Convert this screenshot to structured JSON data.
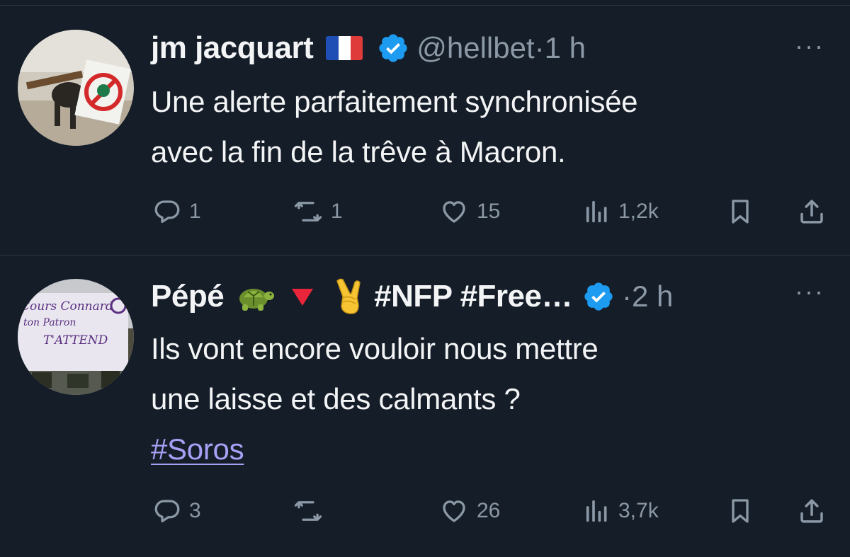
{
  "tweets": [
    {
      "display_name": "jm jacquart",
      "handle": "@hellbet",
      "separator": "·",
      "time": "1 h",
      "text_lines": [
        "Une alerte parfaitement synchronisée",
        "avec la fin de la trêve à Macron."
      ],
      "reply_count": "1",
      "retweet_count": "1",
      "like_count": "15",
      "view_count": "1,2k"
    },
    {
      "display_name": "Pépé",
      "name_suffix": "#NFP #Free…",
      "separator": "·",
      "time": "2 h",
      "text_lines": [
        "Ils vont encore vouloir nous mettre",
        "une laisse et des calmants ?"
      ],
      "hashtag": "#Soros",
      "reply_count": "3",
      "like_count": "26",
      "view_count": "3,7k",
      "avatar_sign_lines": [
        "Cours Connard",
        "ton Patron",
        "T'ATTEND"
      ]
    }
  ],
  "more_label": "···",
  "colors": {
    "background": "#151d28",
    "text": "#f3f4f5",
    "muted": "#8b98a5",
    "verified": "#1d9bf0",
    "hashtag": "#a8a0f5"
  }
}
